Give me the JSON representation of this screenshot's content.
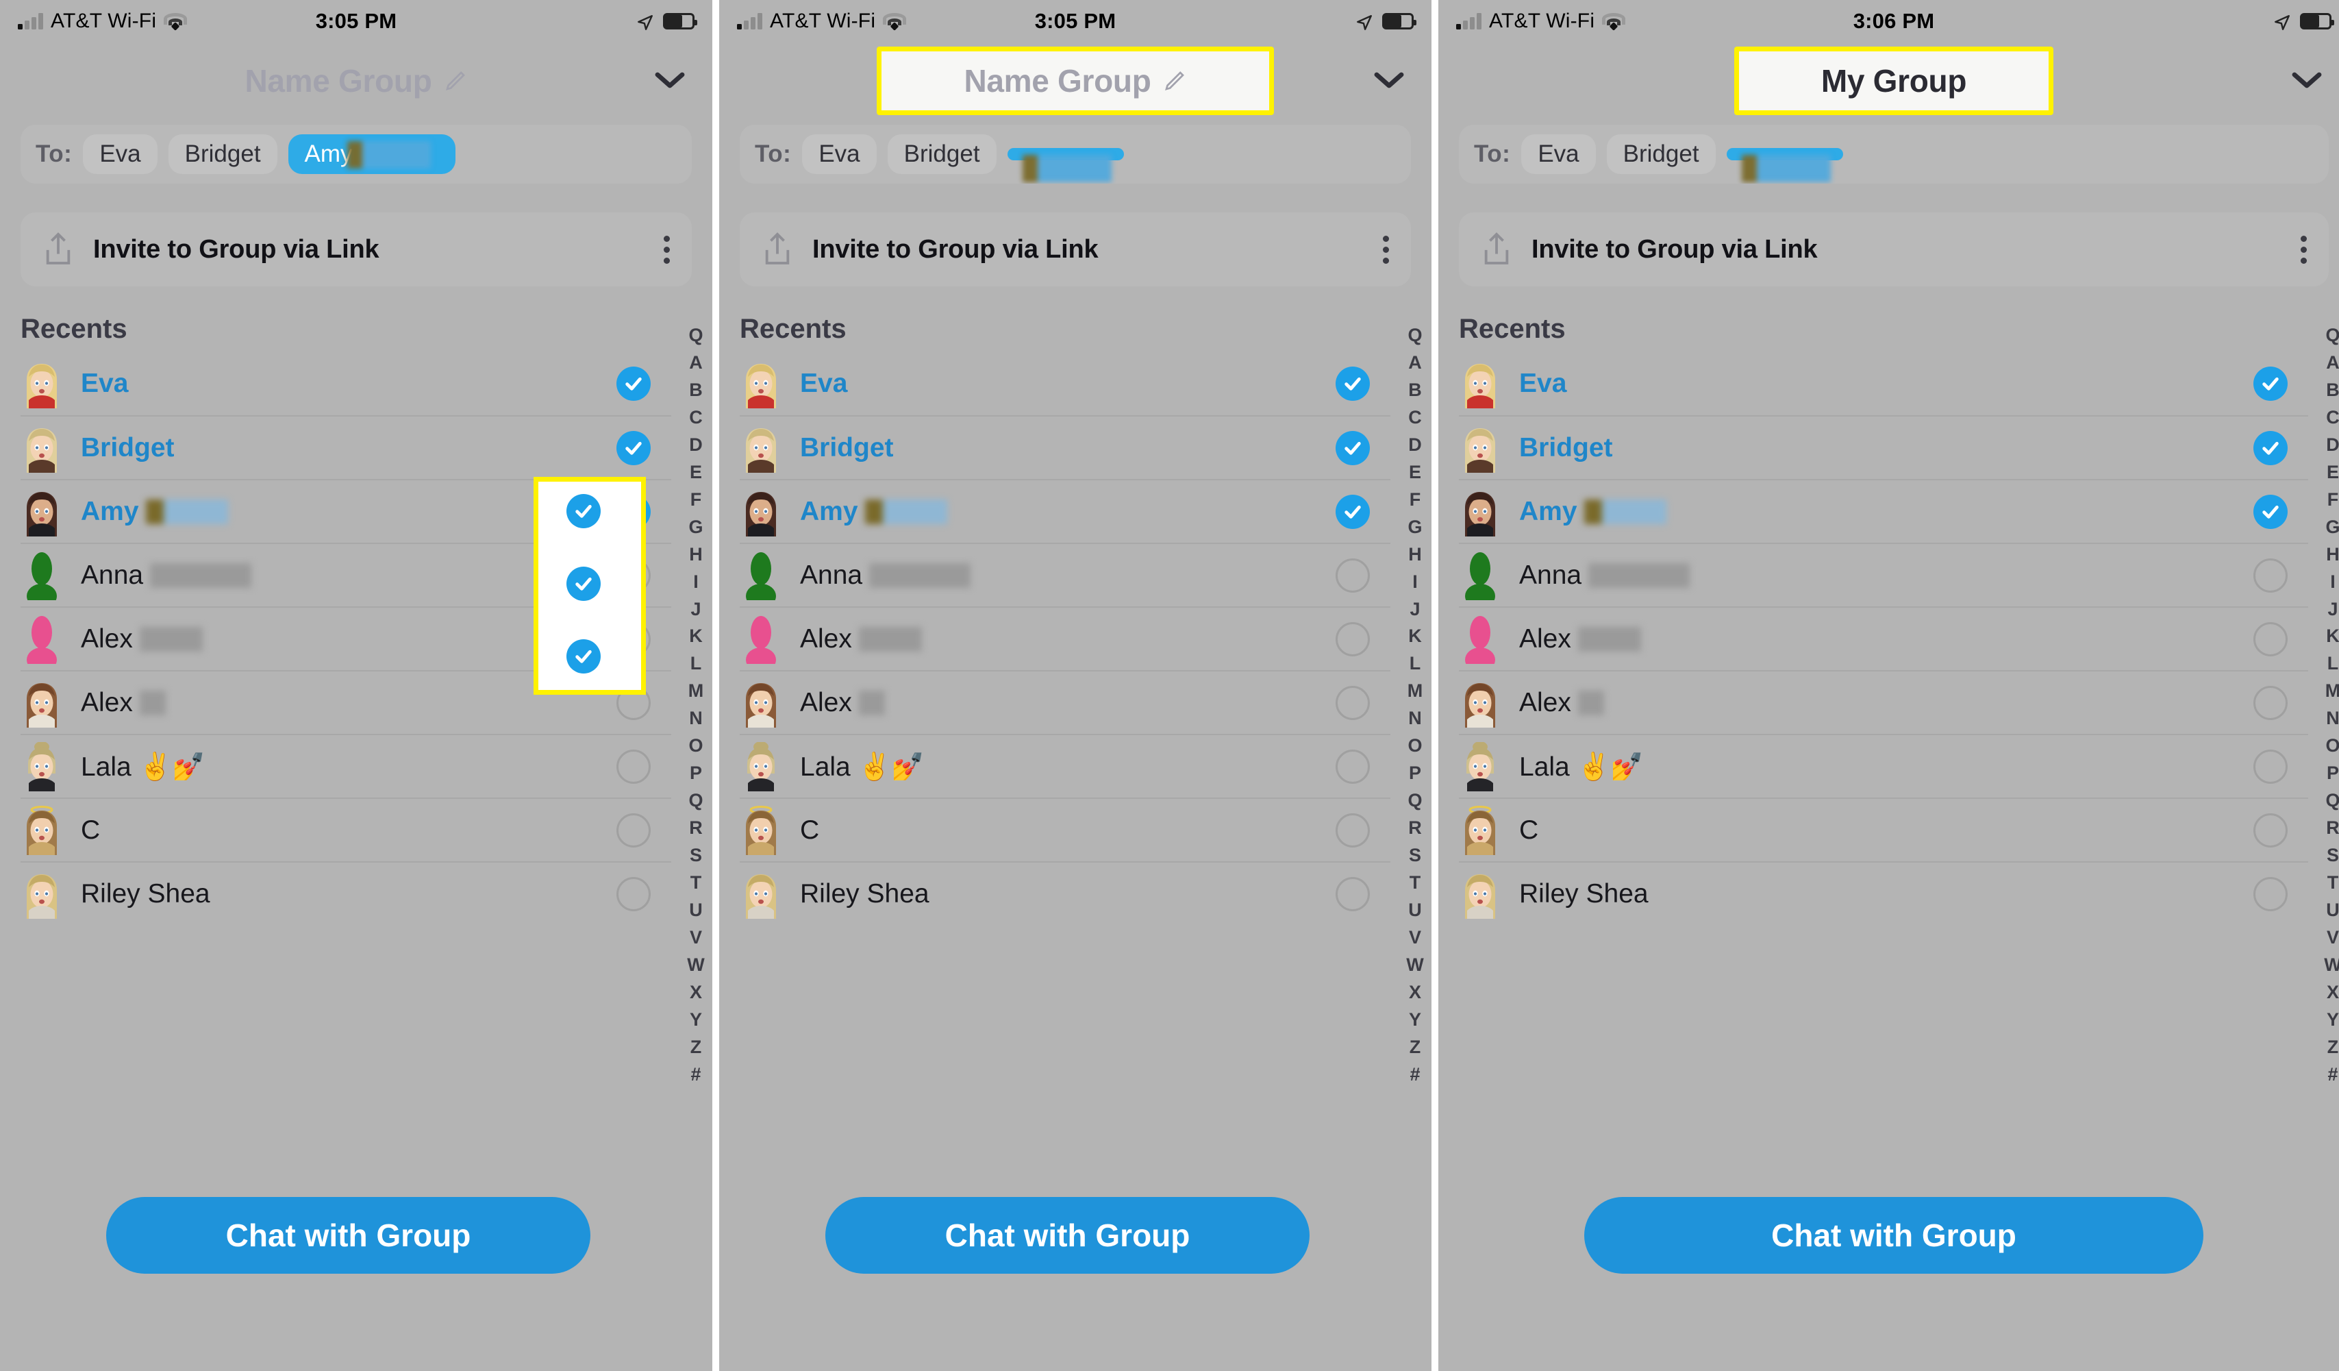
{
  "meta": {
    "app": "Snapchat",
    "screen_title": "Create Group / Name Group",
    "accent_blue": "#1f93da",
    "check_blue": "#1ca0e8",
    "highlight_yellow": "#fff200",
    "dim_background": "#b4b4b4",
    "name_placeholder_color": "#a2a2ad"
  },
  "panels": [
    {
      "id": "panel-1",
      "status": {
        "carrier": "AT&T Wi-Fi",
        "time": "3:05 PM",
        "wifi_icon": "wifi-icon",
        "signal_icon": "cellular-signal-icon",
        "location_icon": "location-arrow-icon",
        "battery_icon": "battery-icon"
      },
      "header": {
        "title": "Name Group",
        "is_placeholder": true,
        "highlighted": false,
        "edit_icon": "pencil-icon",
        "collapse_icon": "chevron-down-icon"
      },
      "to_row": {
        "label": "To:",
        "chips": [
          {
            "text": "Eva",
            "selected": false
          },
          {
            "text": "Bridget",
            "selected": false
          },
          {
            "text": "Amy",
            "selected": true,
            "redacted_suffix": true
          }
        ]
      },
      "invite": {
        "label": "Invite to Group via Link",
        "share_icon": "share-upload-icon",
        "menu_icon": "more-vertical-icon"
      },
      "section_title": "Recents",
      "highlight": {
        "target": "checkbox-column",
        "rows": [
          0,
          1,
          2
        ]
      },
      "chat_button": "Chat with Group",
      "contacts": [
        {
          "name": "Eva",
          "blue": true,
          "checked": true,
          "redacted": "none",
          "avatar": "bitmoji-eva"
        },
        {
          "name": "Bridget",
          "blue": true,
          "checked": true,
          "redacted": "none",
          "avatar": "bitmoji-bridget"
        },
        {
          "name": "Amy",
          "blue": true,
          "checked": true,
          "redacted": "blue-wide",
          "avatar": "bitmoji-amy"
        },
        {
          "name": "Anna",
          "blue": false,
          "checked": false,
          "redacted": "gray-wide",
          "avatar": "silhouette-green"
        },
        {
          "name": "Alex",
          "blue": false,
          "checked": false,
          "redacted": "gray-med",
          "avatar": "silhouette-pink"
        },
        {
          "name": "Alex",
          "blue": false,
          "checked": false,
          "redacted": "gray-small",
          "avatar": "bitmoji-alex"
        },
        {
          "name": "Lala ✌️💅",
          "blue": false,
          "checked": false,
          "redacted": "none",
          "avatar": "bitmoji-lala"
        },
        {
          "name": "C",
          "blue": false,
          "checked": false,
          "redacted": "none",
          "avatar": "bitmoji-angel"
        },
        {
          "name": "Riley Shea",
          "blue": false,
          "checked": false,
          "redacted": "none",
          "avatar": "bitmoji-riley"
        }
      ]
    },
    {
      "id": "panel-2",
      "status": {
        "carrier": "AT&T Wi-Fi",
        "time": "3:05 PM",
        "wifi_icon": "wifi-icon",
        "signal_icon": "cellular-signal-icon",
        "location_icon": "location-arrow-icon",
        "battery_icon": "battery-icon"
      },
      "header": {
        "title": "Name Group",
        "is_placeholder": true,
        "highlighted": true,
        "edit_icon": "pencil-icon",
        "collapse_icon": "chevron-down-icon"
      },
      "to_row": {
        "label": "To:",
        "chips": [
          {
            "text": "Eva",
            "selected": false
          },
          {
            "text": "Bridget",
            "selected": false
          },
          {
            "text": "",
            "selected": true,
            "redacted_suffix": true
          }
        ]
      },
      "invite": {
        "label": "Invite to Group via Link",
        "share_icon": "share-upload-icon",
        "menu_icon": "more-vertical-icon"
      },
      "section_title": "Recents",
      "highlight": {
        "target": "group-name-field",
        "rows": []
      },
      "chat_button": "Chat with Group",
      "contacts": [
        {
          "name": "Eva",
          "blue": true,
          "checked": true,
          "redacted": "none",
          "avatar": "bitmoji-eva"
        },
        {
          "name": "Bridget",
          "blue": true,
          "checked": true,
          "redacted": "none",
          "avatar": "bitmoji-bridget"
        },
        {
          "name": "Amy",
          "blue": true,
          "checked": true,
          "redacted": "blue-wide",
          "avatar": "bitmoji-amy"
        },
        {
          "name": "Anna",
          "blue": false,
          "checked": false,
          "redacted": "gray-wide",
          "avatar": "silhouette-green"
        },
        {
          "name": "Alex",
          "blue": false,
          "checked": false,
          "redacted": "gray-med",
          "avatar": "silhouette-pink"
        },
        {
          "name": "Alex",
          "blue": false,
          "checked": false,
          "redacted": "gray-small",
          "avatar": "bitmoji-alex"
        },
        {
          "name": "Lala ✌️💅",
          "blue": false,
          "checked": false,
          "redacted": "none",
          "avatar": "bitmoji-lala"
        },
        {
          "name": "C",
          "blue": false,
          "checked": false,
          "redacted": "none",
          "avatar": "bitmoji-angel"
        },
        {
          "name": "Riley Shea",
          "blue": false,
          "checked": false,
          "redacted": "none",
          "avatar": "bitmoji-riley"
        }
      ]
    },
    {
      "id": "panel-3",
      "status": {
        "carrier": "AT&T Wi-Fi",
        "time": "3:06 PM",
        "wifi_icon": "wifi-icon",
        "signal_icon": "cellular-signal-icon",
        "location_icon": "location-arrow-icon",
        "battery_icon": "battery-icon"
      },
      "header": {
        "title": "My Group",
        "is_placeholder": false,
        "highlighted": true,
        "edit_icon": "none",
        "collapse_icon": "chevron-down-icon"
      },
      "to_row": {
        "label": "To:",
        "chips": [
          {
            "text": "Eva",
            "selected": false
          },
          {
            "text": "Bridget",
            "selected": false
          },
          {
            "text": "",
            "selected": true,
            "redacted_suffix": true
          }
        ]
      },
      "invite": {
        "label": "Invite to Group via Link",
        "share_icon": "share-upload-icon",
        "menu_icon": "more-vertical-icon"
      },
      "section_title": "Recents",
      "highlight": {
        "target": "group-name-field",
        "rows": []
      },
      "chat_button": "Chat with Group",
      "contacts": [
        {
          "name": "Eva",
          "blue": true,
          "checked": true,
          "redacted": "none",
          "avatar": "bitmoji-eva"
        },
        {
          "name": "Bridget",
          "blue": true,
          "checked": true,
          "redacted": "none",
          "avatar": "bitmoji-bridget"
        },
        {
          "name": "Amy",
          "blue": true,
          "checked": true,
          "redacted": "blue-wide",
          "avatar": "bitmoji-amy"
        },
        {
          "name": "Anna",
          "blue": false,
          "checked": false,
          "redacted": "gray-wide",
          "avatar": "silhouette-green"
        },
        {
          "name": "Alex",
          "blue": false,
          "checked": false,
          "redacted": "gray-med",
          "avatar": "silhouette-pink"
        },
        {
          "name": "Alex",
          "blue": false,
          "checked": false,
          "redacted": "gray-small",
          "avatar": "bitmoji-alex"
        },
        {
          "name": "Lala ✌️💅",
          "blue": false,
          "checked": false,
          "redacted": "none",
          "avatar": "bitmoji-lala"
        },
        {
          "name": "C",
          "blue": false,
          "checked": false,
          "redacted": "none",
          "avatar": "bitmoji-angel"
        },
        {
          "name": "Riley Shea",
          "blue": false,
          "checked": false,
          "redacted": "none",
          "avatar": "bitmoji-riley"
        }
      ]
    }
  ],
  "alphabet_index": [
    "Q",
    "A",
    "B",
    "C",
    "D",
    "E",
    "F",
    "G",
    "H",
    "I",
    "J",
    "K",
    "L",
    "M",
    "N",
    "O",
    "P",
    "Q",
    "R",
    "S",
    "T",
    "U",
    "V",
    "W",
    "X",
    "Y",
    "Z",
    "#"
  ]
}
